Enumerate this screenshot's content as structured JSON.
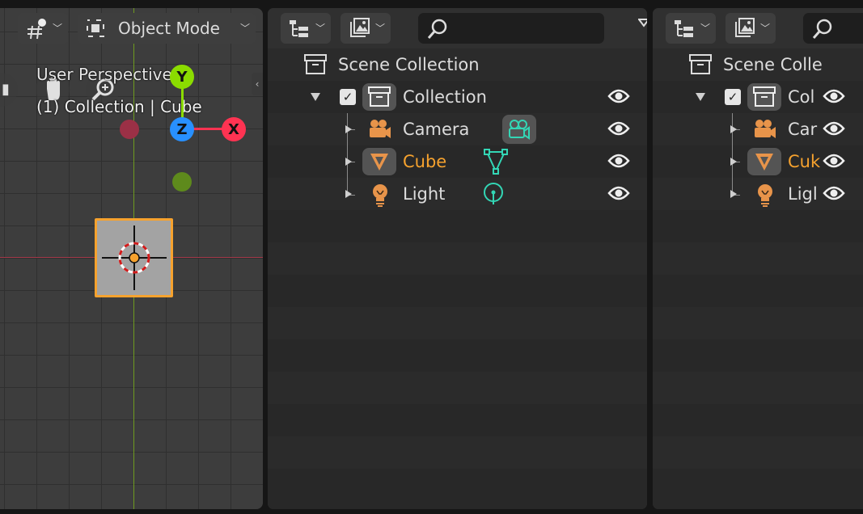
{
  "viewport": {
    "header": {
      "mode_label": "Object Mode"
    },
    "overlay": {
      "perspective": "User Perspective",
      "selection": "(1) Collection | Cube"
    },
    "gizmo": {
      "x": "X",
      "y": "Y",
      "z": "Z"
    },
    "colors": {
      "selected": "#f6a22e",
      "x_axis": "#ff3352",
      "y_axis": "#8bdc00",
      "z_axis": "#2890ff"
    }
  },
  "outliner_left": {
    "scene_collection": "Scene Collection",
    "collection": "Collection",
    "items": [
      {
        "label": "Camera",
        "type": "camera",
        "active": false
      },
      {
        "label": "Cube",
        "type": "mesh",
        "active": true
      },
      {
        "label": "Light",
        "type": "light",
        "active": false
      }
    ]
  },
  "outliner_right": {
    "scene_collection": "Scene Colle",
    "collection": "Col",
    "items": [
      {
        "label": "Car",
        "type": "camera",
        "active": false
      },
      {
        "label": "Cuk",
        "type": "mesh",
        "active": true
      },
      {
        "label": "Ligl",
        "type": "light",
        "active": false
      }
    ]
  },
  "icons": {
    "view_type": "object-transform-icon",
    "mode": "object-mode-icon",
    "display_mode": "outliner-display-mode-icon",
    "filter": "filter-icon",
    "search": "search-icon",
    "visibility": "eye-icon"
  }
}
